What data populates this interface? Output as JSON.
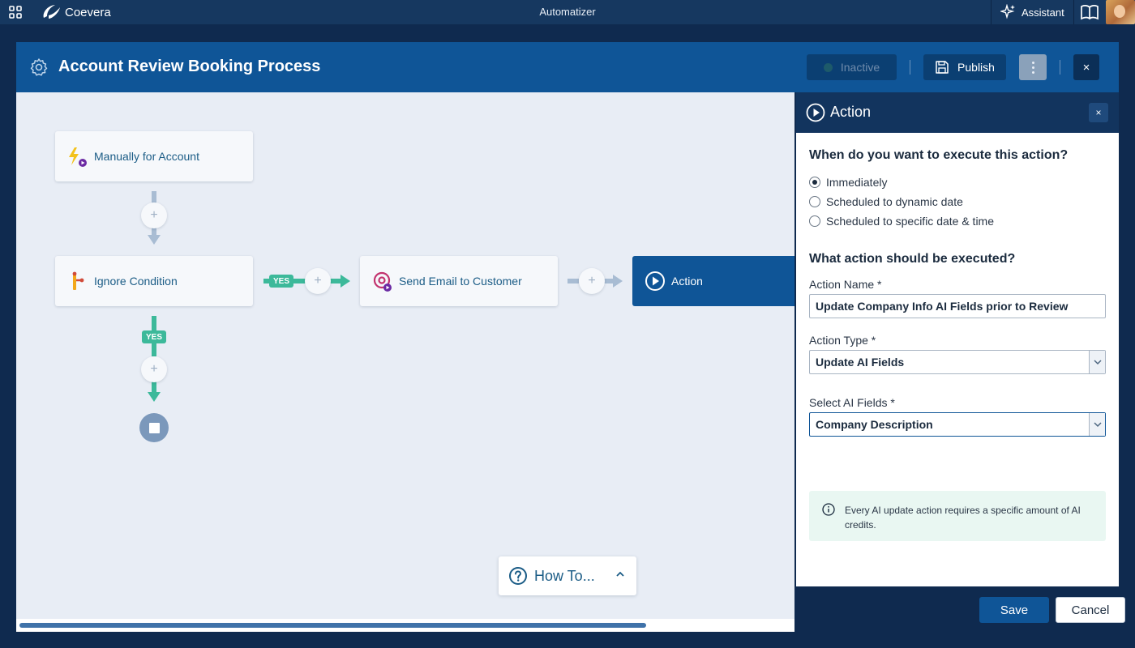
{
  "topbar": {
    "brand": "Coevera",
    "app_title": "Automatizer",
    "assistant_label": "Assistant"
  },
  "workflow": {
    "title": "Account Review Booking Process",
    "status_label": "Inactive",
    "publish_label": "Publish",
    "close_glyph": "×"
  },
  "canvas": {
    "trigger_label": "Manually for Account",
    "condition_label": "Ignore Condition",
    "email_label": "Send Email to Customer",
    "action_label": "Action",
    "yes_label": "YES",
    "plus_glyph": "+",
    "howto_label": "How To..."
  },
  "panel": {
    "title": "Action",
    "close_glyph": "×",
    "when_question": "When do you want to execute this action?",
    "schedule_options": [
      {
        "label": "Immediately",
        "selected": true
      },
      {
        "label": "Scheduled to dynamic date",
        "selected": false
      },
      {
        "label": "Scheduled to specific date & time",
        "selected": false
      }
    ],
    "what_question": "What action should be executed?",
    "action_name_label": "Action Name *",
    "action_name_value": "Update Company Info AI Fields prior to Review",
    "action_type_label": "Action Type *",
    "action_type_value": "Update AI Fields",
    "ai_fields_label": "Select AI Fields *",
    "ai_fields_value": "Company Description",
    "info_note": "Every AI update action requires a specific amount of AI credits.",
    "save_label": "Save",
    "cancel_label": "Cancel"
  },
  "colors": {
    "header_blue": "#0f5597",
    "navy": "#0f2a4f",
    "yes_green": "#3cb99a",
    "canvas_bg": "#e8edf5"
  }
}
